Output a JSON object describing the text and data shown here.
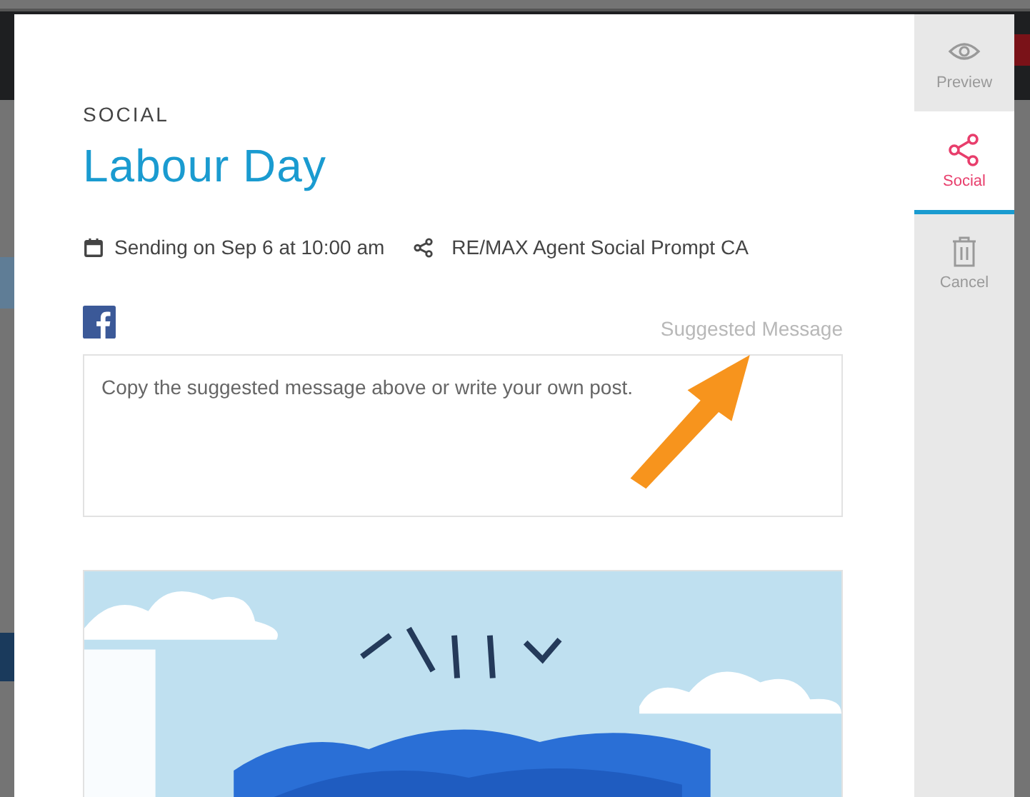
{
  "modal": {
    "category": "SOCIAL",
    "title": "Labour Day",
    "schedule": "Sending on Sep 6 at 10:00 am",
    "account": "RE/MAX Agent Social Prompt CA",
    "suggested_label": "Suggested Message",
    "message": {
      "placeholder": "Copy the suggested message above or write your own post."
    }
  },
  "sidebar": {
    "items": [
      {
        "label": "Preview",
        "kind": "preview",
        "selected": false
      },
      {
        "label": "Social",
        "kind": "social",
        "selected": true
      },
      {
        "label": "Cancel",
        "kind": "cancel",
        "selected": false
      }
    ]
  }
}
